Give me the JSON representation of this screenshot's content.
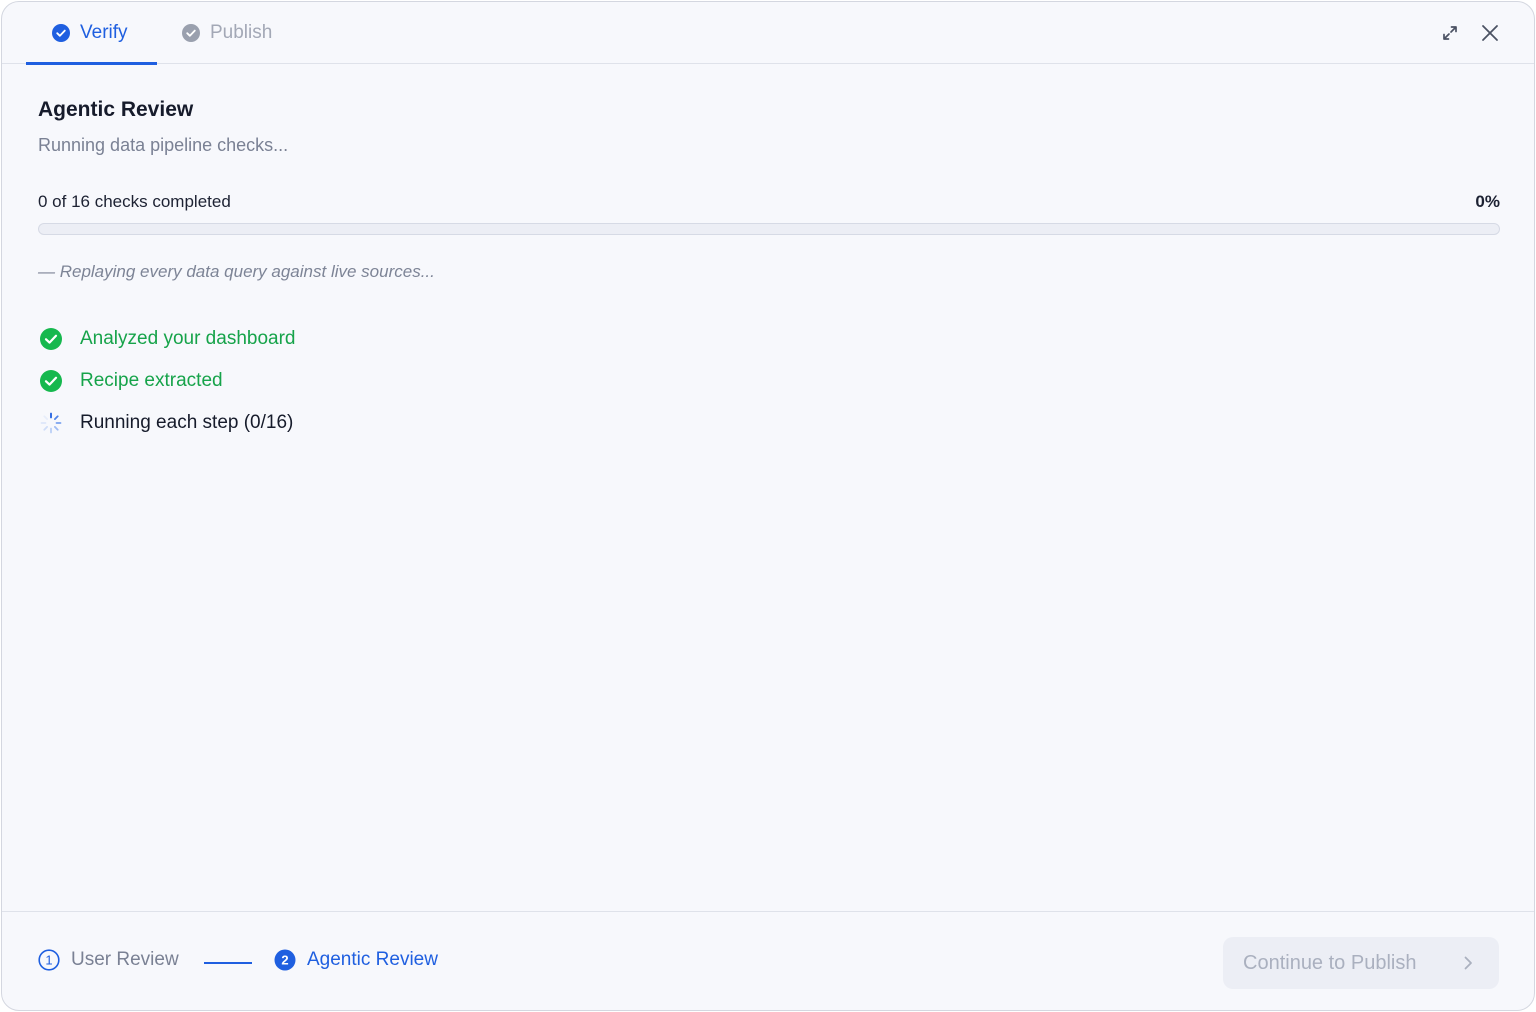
{
  "tabs": [
    {
      "label": "Verify",
      "icon": "check-circle-icon",
      "active": true
    },
    {
      "label": "Publish",
      "icon": "check-circle-icon",
      "active": false
    }
  ],
  "header_actions": {
    "expand_icon": "expand-icon",
    "close_icon": "close-icon"
  },
  "main": {
    "title": "Agentic Review",
    "subtitle": "Running data pipeline checks...",
    "progress": {
      "label": "0 of 16 checks completed",
      "percent_label": "0%",
      "value": 0
    },
    "note": "— Replaying every data query against live sources...",
    "steps": [
      {
        "label": "Analyzed your dashboard",
        "status": "done",
        "icon": "check-circle-icon"
      },
      {
        "label": "Recipe extracted",
        "status": "done",
        "icon": "check-circle-icon"
      },
      {
        "label": "Running each step (0/16)",
        "status": "running",
        "icon": "spinner-icon"
      }
    ]
  },
  "footer": {
    "stepper": [
      {
        "number": "1",
        "label": "User Review",
        "active": false
      },
      {
        "number": "2",
        "label": "Agentic Review",
        "active": true
      }
    ],
    "continue_label": "Continue to Publish",
    "continue_disabled": true
  },
  "colors": {
    "accent": "#1f5fe0",
    "success": "#16a34a",
    "muted": "#7a8194",
    "background": "#f7f8fc"
  }
}
